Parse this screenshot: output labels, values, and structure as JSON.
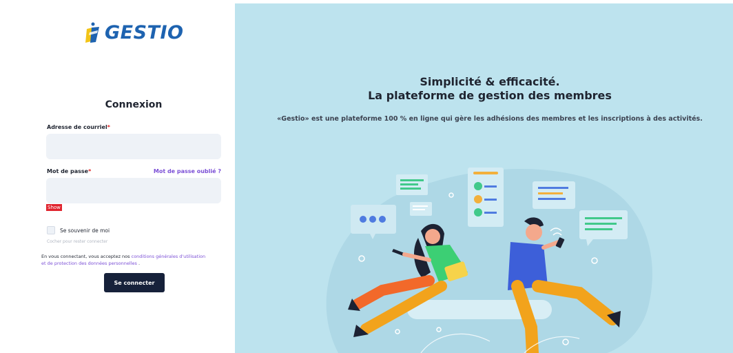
{
  "brand": {
    "name": "GESTIO"
  },
  "login": {
    "title": "Connexion",
    "email_label": "Adresse de courriel",
    "required_mark": "*",
    "email_value": "",
    "password_label": "Mot de passe",
    "forgot_link": "Mot de passe oublié ?",
    "password_value": "",
    "show_toggle": "Show",
    "remember_label": "Se souvenir de moi",
    "remember_hint": "Cocher pour rester connecter",
    "terms_prefix": "En vous connectant, vous acceptez nos",
    "terms_link_1": "conditions générales d'utilisation",
    "terms_and": "et de",
    "terms_link_2": "protection des données personnelles",
    "terms_suffix": ".",
    "submit_label": "Se connecter"
  },
  "hero": {
    "title_line_1": "Simplicité & efficacité.",
    "title_line_2": "La plateforme de gestion des membres",
    "description": "«Gestio» est une plateforme 100 % en ligne qui gère les adhésions des membres et les inscriptions à des activités."
  },
  "colors": {
    "brand_blue": "#1e63b0",
    "accent_purple": "#7b4fd6",
    "required_red": "#e02424",
    "button_dark": "#16213a",
    "hero_bg": "#bde3ee"
  },
  "icons": [
    "gestio-logo-icon",
    "dots-chat-icon",
    "people-list-icon",
    "message-lines-icon"
  ]
}
